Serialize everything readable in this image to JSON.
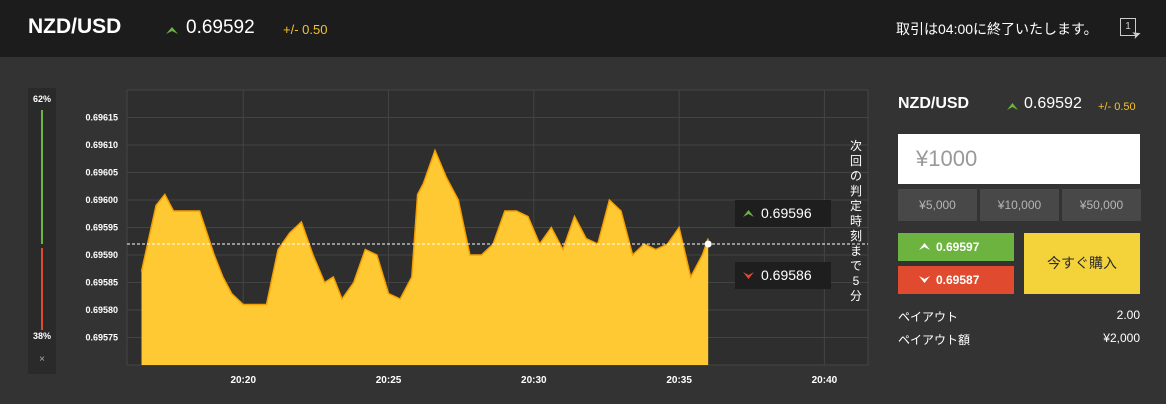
{
  "header": {
    "pair": "NZD/USD",
    "rate": "0.69592",
    "change": "+/- 0.50",
    "notice": "取引は04:00に終了いたします。",
    "window_icon_label": "1"
  },
  "ratio": {
    "high_percent": "62%",
    "low_percent": "38%",
    "high_fraction": 0.62,
    "close_label": "×"
  },
  "chart_data": {
    "type": "area",
    "y_ticks": [
      "0.69615",
      "0.69610",
      "0.69605",
      "0.69600",
      "0.69595",
      "0.69590",
      "0.69585",
      "0.69580",
      "0.69575"
    ],
    "x_ticks": [
      "20:20",
      "20:25",
      "20:30",
      "20:35",
      "20:40"
    ],
    "ylim": [
      0.6957,
      0.6962
    ],
    "current_level": 0.69592,
    "x_minutes": [
      16.5,
      17.0,
      17.3,
      17.6,
      18.0,
      18.5,
      19.0,
      19.3,
      19.6,
      20.0,
      20.4,
      20.8,
      21.2,
      21.6,
      22.0,
      22.4,
      22.8,
      23.1,
      23.4,
      23.8,
      24.2,
      24.6,
      25.0,
      25.4,
      25.8,
      26.0,
      26.2,
      26.6,
      27.0,
      27.4,
      27.8,
      28.2,
      28.6,
      29.0,
      29.4,
      29.8,
      30.2,
      30.6,
      31.0,
      31.4,
      31.8,
      32.2,
      32.6,
      33.0,
      33.4,
      33.8,
      34.2,
      34.6,
      35.0,
      35.4,
      35.8,
      36.0
    ],
    "values": [
      0.69587,
      0.69599,
      0.69601,
      0.69598,
      0.69598,
      0.69598,
      0.6959,
      0.69586,
      0.69583,
      0.69581,
      0.69581,
      0.69581,
      0.69591,
      0.69594,
      0.69596,
      0.6959,
      0.69585,
      0.69586,
      0.69582,
      0.69585,
      0.69591,
      0.6959,
      0.69583,
      0.69582,
      0.69586,
      0.69601,
      0.69603,
      0.69609,
      0.69604,
      0.696,
      0.6959,
      0.6959,
      0.69592,
      0.69598,
      0.69598,
      0.69597,
      0.69592,
      0.69595,
      0.69591,
      0.69597,
      0.69593,
      0.69592,
      0.696,
      0.69598,
      0.6959,
      0.69592,
      0.69591,
      0.69592,
      0.69595,
      0.69586,
      0.6959,
      0.69593
    ],
    "up_tag": "0.69596",
    "down_tag": "0.69586",
    "next_judge": "次回の判定時刻まで5分",
    "fill_color": "#ffc933",
    "line_color": "#f5a000"
  },
  "trade_panel": {
    "pair": "NZD/USD",
    "rate": "0.69592",
    "change": "+/- 0.50",
    "amount_value": "¥1000",
    "quick_amounts": [
      "¥5,000",
      "¥10,000",
      "¥50,000"
    ],
    "high_price": "0.69597",
    "low_price": "0.69587",
    "buy_label": "今すぐ購入",
    "payout_label": "ペイアウト",
    "payout_value": "2.00",
    "payout_amount_label": "ペイアウト額",
    "payout_amount_value": "¥2,000"
  },
  "colors": {
    "up": "#6cb33f",
    "down": "#e04b2f",
    "accent": "#f2c12e"
  }
}
